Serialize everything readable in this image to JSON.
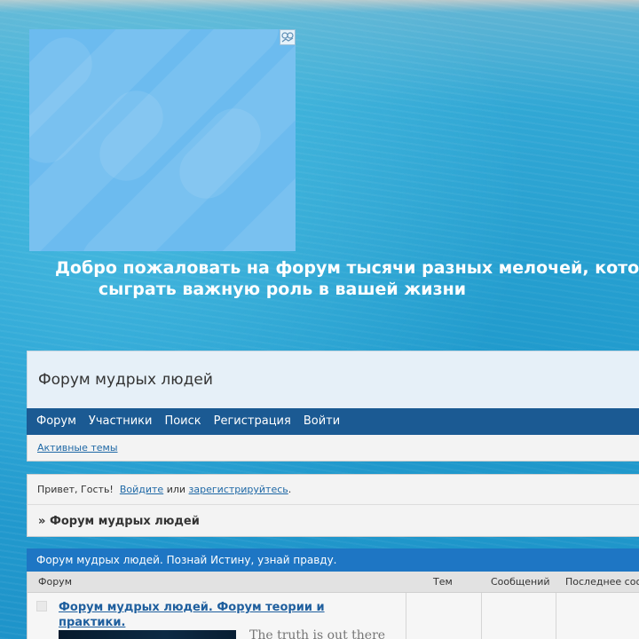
{
  "welcome": {
    "line1": "Добро пожаловать на форум тысячи разных мелочей, кото",
    "line2": "сыграть важную роль в вашей жизни"
  },
  "header": {
    "title": "Форум мудрых людей"
  },
  "nav": {
    "items": [
      "Форум",
      "Участники",
      "Поиск",
      "Регистрация",
      "Войти"
    ]
  },
  "subnav": {
    "active_topics": "Активные темы"
  },
  "greeting": {
    "prefix": "Привет, Гость!",
    "login_link": "Войдите",
    "or": "или",
    "register_link": "зарегистрируйтесь",
    "suffix": "."
  },
  "breadcrumb": {
    "marker": "»",
    "current": "Форум мудрых людей"
  },
  "category": {
    "title": "Форум мудрых людей. Познай Истину, узнай правду."
  },
  "table": {
    "columns": [
      "Форум",
      "Тем",
      "Сообщений",
      "Последнее соо"
    ]
  },
  "forum_row": {
    "title": "Форум мудрых людей. Форум теории и практики.",
    "description": "The truth is out there"
  },
  "colors": {
    "navbar": "#1b5a93",
    "category_bar": "#1e76c4",
    "link": "#2069a6"
  }
}
